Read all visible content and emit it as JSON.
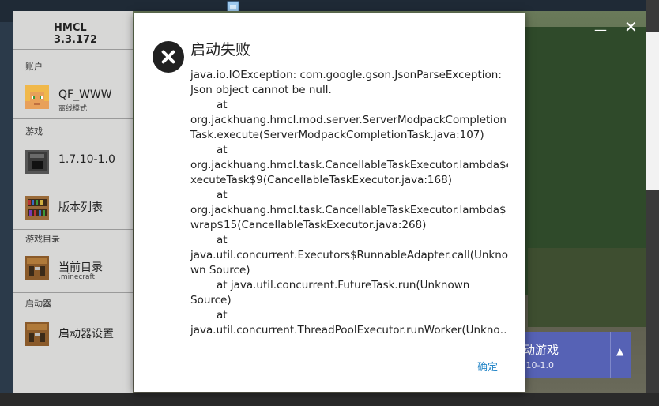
{
  "window": {
    "title": "HMCL 3.3.172",
    "minimize_glyph": "—",
    "close_glyph": "✕"
  },
  "sidebar": {
    "sections": [
      {
        "label": "账户"
      },
      {
        "label": "游戏"
      },
      {
        "label": "游戏目录"
      },
      {
        "label": "启动器"
      }
    ],
    "account": {
      "name": "QF_WWW",
      "mode": "离线模式",
      "icon": "player-head-icon"
    },
    "game_version": {
      "label": "1.7.10-1.0",
      "icon": "furnace-icon"
    },
    "version_list": {
      "label": "版本列表",
      "icon": "bookshelf-icon"
    },
    "current_dir": {
      "label": "当前目录",
      "sub": ".minecraft",
      "icon": "crafting-table-icon"
    },
    "launcher_settings": {
      "label": "启动器设置",
      "icon": "crafting-table-icon"
    }
  },
  "launch_button": {
    "label": "动游戏",
    "version": ".10-1.0",
    "arrow": "▲",
    "color": "#5662b5"
  },
  "dialog": {
    "title": "启动失败",
    "icon": "error-x-icon",
    "lines": [
      {
        "text": "java.io.IOException: com.google.gson.JsonParseException:",
        "indent": false
      },
      {
        "text": "Json object cannot be null.",
        "indent": false
      },
      {
        "text": "at",
        "indent": true
      },
      {
        "text": "org.jackhuang.hmcl.mod.server.ServerModpackCompletion",
        "indent": false
      },
      {
        "text": "Task.execute(ServerModpackCompletionTask.java:107)",
        "indent": false
      },
      {
        "text": "at",
        "indent": true
      },
      {
        "text": "org.jackhuang.hmcl.task.CancellableTaskExecutor.lambda$e",
        "indent": false
      },
      {
        "text": "xecuteTask$9(CancellableTaskExecutor.java:168)",
        "indent": false
      },
      {
        "text": "at",
        "indent": true
      },
      {
        "text": "org.jackhuang.hmcl.task.CancellableTaskExecutor.lambda$",
        "indent": false
      },
      {
        "text": "wrap$15(CancellableTaskExecutor.java:268)",
        "indent": false
      },
      {
        "text": "at",
        "indent": true
      },
      {
        "text": "java.util.concurrent.Executors$RunnableAdapter.call(Unkno",
        "indent": false
      },
      {
        "text": "wn Source)",
        "indent": false
      },
      {
        "text": "at java.util.concurrent.FutureTask.run(Unknown",
        "indent": true
      },
      {
        "text": "Source)",
        "indent": false
      },
      {
        "text": "at",
        "indent": true
      },
      {
        "text": "java.util.concurrent.ThreadPoolExecutor.runWorker(Unkno…",
        "indent": false
      }
    ],
    "ok_label": "确定",
    "accent": "#2a89c9"
  }
}
